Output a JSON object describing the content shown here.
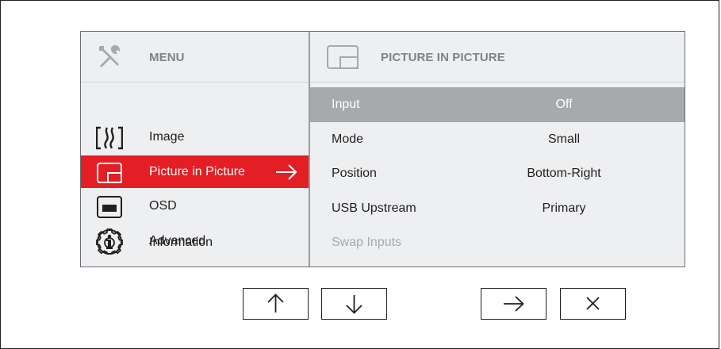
{
  "left_menu": {
    "header": "MENU",
    "items": [
      {
        "label": "Image",
        "icon": "image-icon"
      },
      {
        "label": "Picture in Picture",
        "icon": "pip-icon",
        "selected": true
      },
      {
        "label": "OSD",
        "icon": "osd-icon"
      },
      {
        "label": "Advanced",
        "icon": "gear-icon"
      },
      {
        "label": "Information",
        "icon": "info-icon"
      }
    ]
  },
  "pip_panel": {
    "header": "PICTURE IN PICTURE",
    "rows": [
      {
        "name": "Input",
        "value": "Off",
        "highlighted": true
      },
      {
        "name": "Mode",
        "value": "Small"
      },
      {
        "name": "Position",
        "value": "Bottom-Right"
      },
      {
        "name": "USB Upstream",
        "value": "Primary"
      },
      {
        "name": "Swap Inputs",
        "value": "",
        "disabled": true
      }
    ]
  },
  "buttons": [
    {
      "icon": "arrow-up-icon"
    },
    {
      "icon": "arrow-down-icon"
    },
    {
      "icon": "arrow-right-icon"
    },
    {
      "icon": "close-icon"
    }
  ],
  "colors": {
    "accent": "#e31e24",
    "highlight_row": "#a7a9ac",
    "panel_bg": "#eeeff0"
  }
}
